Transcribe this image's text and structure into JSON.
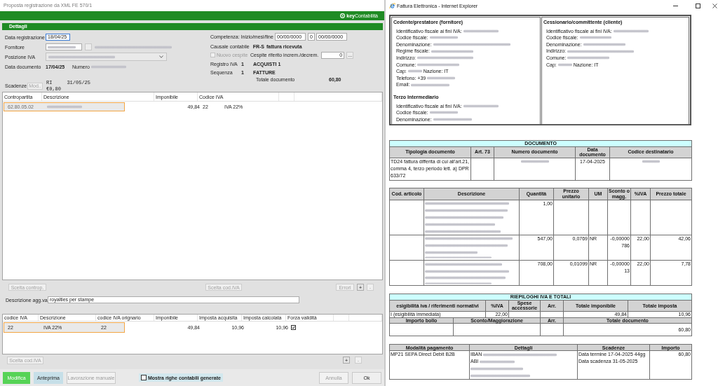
{
  "app_window": {
    "title": "Proposta registrazione da XML FE 570/1",
    "logo": "**key**Contabilità",
    "panel": {
      "title": "Dettagli",
      "left_fields": [
        {
          "kind": "input",
          "label": "Data registrazione",
          "value": "18/04/25",
          "focused": true
        },
        {
          "kind": "lookup",
          "label": "Fornitore",
          "value_blurred": true,
          "name_blurred": true
        },
        {
          "kind": "select",
          "label": "Posizione IVA",
          "blurred": true
        },
        {
          "kind": "document",
          "label": "Data documento",
          "value": "17/04/25",
          "number_label": "Numero",
          "blurred": true
        }
      ],
      "due_dates": {
        "label": "Scadenze",
        "button": {
          "label": "Mod..",
          "disabled": true
        },
        "lines": [
          "RI     31/05/25",
          "€0,80"
        ]
      },
      "right_fields": [
        {
          "kind": "dates",
          "label": "Competenza: Inizio/mesi/fine",
          "start": "00/00/0000",
          "months": "0",
          "end": "00/00/0000"
        },
        {
          "kind": "code",
          "label": "Causale contabile",
          "code": "FR-S",
          "text": "fattura ricevuta"
        },
        {
          "kind": "asset",
          "checkbox": {
            "label": "Nuovo cespite",
            "checked": false,
            "disabled": true
          },
          "label": "Cespite riferito increm./decrem.",
          "value": "0",
          "button": "..."
        },
        {
          "kind": "code",
          "label": "Registro IVA",
          "code": "1",
          "text": "ACQUISTI 1"
        },
        {
          "kind": "code",
          "label": "Sequenza",
          "code": "1",
          "text": "FATTURE"
        },
        {
          "kind": "total",
          "label": "Totale documento",
          "value": "60,80"
        }
      ]
    },
    "accounts_grid": {
      "columns": [
        "Contropartita",
        "Descrizione",
        "Imponibile",
        "Codice IVA"
      ],
      "rows": [
        {
          "selected": true,
          "account": "62.80.05.02",
          "description_blurred": true,
          "taxable": "49,84",
          "vat_code": "22",
          "vat_description": "IVA 22%"
        }
      ]
    },
    "accounts_buttons": [
      {
        "label": "Scelta controp.",
        "disabled": true
      },
      {
        "label": "Scelta cod.IVA",
        "disabled": true
      },
      {
        "label": "Errori",
        "disabled": true
      },
      {
        "label": "+",
        "disabled": false
      },
      {
        "label": "-",
        "disabled": true
      }
    ],
    "additional_description": {
      "label": "Descrizione agg.va",
      "value": "royalties per stampe"
    },
    "vat_grid": {
      "columns": [
        "codice IVA",
        "Descrizione",
        "codice IVA orignario",
        "Imponibile",
        "Imposta acquisita",
        "Imposta calcolata",
        "Forza validità"
      ],
      "rows": [
        {
          "selected": true,
          "vat_code": "22",
          "description": "IVA 22%",
          "original_vat_code": "22",
          "taxable": "49,84",
          "tax_received": "10,96",
          "tax_computed": "10,96",
          "force_valid": true
        }
      ]
    },
    "vat_buttons": [
      {
        "label": "Scelta cod.IVA",
        "disabled": true
      },
      {
        "label": "+",
        "disabled": false
      },
      {
        "label": "-",
        "disabled": true
      }
    ],
    "footer": {
      "buttons": [
        {
          "label": "Modifica",
          "kind": "primary",
          "disabled": false
        },
        {
          "label": "Anteprima",
          "kind": "secondary",
          "disabled": false
        },
        {
          "label": "Lavorazione manuale",
          "kind": "default",
          "disabled": true
        }
      ],
      "checkbox": {
        "label": "Mostra righe contabili generate",
        "checked": false
      },
      "dialog_buttons": [
        {
          "label": "Annulla",
          "disabled": true
        },
        {
          "label": "Ok",
          "disabled": false
        }
      ]
    }
  },
  "browser_window": {
    "title": "Fattura Elettronica - Internet Explorer",
    "parties": [
      [
        {
          "title": "Cedente/prestatore (fornitore)",
          "lines": [
            {
              "label": "Identificativo fiscale ai fini IVA:",
              "blurred": true
            },
            {
              "label": "Codice fiscale:",
              "blurred": true
            },
            {
              "label": "Denominazione:",
              "blurred": true
            },
            {
              "label": "Regime fiscale:",
              "blurred": true
            },
            {
              "label": "Indirizzo:",
              "blurred": true
            },
            {
              "label": "Comune:",
              "blurred": true
            },
            {
              "label": "Cap:",
              "blurred": true,
              "suffix": "Nazione: IT"
            },
            {
              "label": "Telefono: +39",
              "blurred": true
            },
            {
              "label": "Email:",
              "blurred": true
            }
          ]
        },
        {
          "title": "Terzo Intermediario",
          "lines": [
            {
              "label": "Identificativo fiscale ai fini IVA:",
              "blurred": true
            },
            {
              "label": "Codice fiscale:",
              "blurred": true
            },
            {
              "label": "Denominazione:",
              "blurred": true
            }
          ]
        }
      ],
      [
        {
          "title": "Cessionario/committente (cliente)",
          "lines": [
            {
              "label": "Identificativo fiscale ai fini IVA:",
              "blurred": true
            },
            {
              "label": "Codice fiscale:",
              "blurred": true
            },
            {
              "label": "Denominazione:",
              "blurred": true
            },
            {
              "label": "Indirizzo:",
              "blurred": true
            },
            {
              "label": "Comune:",
              "blurred": true
            },
            {
              "label": "Cap:",
              "blurred": true,
              "suffix": "Nazione: IT"
            }
          ]
        }
      ]
    ],
    "document": {
      "title": "DOCUMENTO",
      "columns": [
        "Tipologia documento",
        "Art. 73",
        "Numero documento",
        "Data documento",
        "Codice destinatario"
      ],
      "rows": [
        [
          "TD24 fattura differita di cui all'art.21, comma 4, terzo periodo lett. a) DPR 633/72",
          null,
          {
            "lines": [
              {
                "blurred": true
              }
            ]
          },
          "17-04-2025",
          {
            "lines": [
              {
                "blurred": true
              }
            ]
          }
        ]
      ]
    },
    "items": {
      "columns": [
        "Cod. articolo",
        "Descrizione",
        "Quantità",
        "Prezzo unitario",
        "UM",
        "Sconto o magg.",
        "%IVA",
        "Prezzo totale"
      ],
      "rows": [
        [
          null,
          {
            "lines": [
              {
                "blurred": true
              },
              {
                "blurred": true
              },
              {
                "blurred": true
              },
              {
                "blurred": true
              },
              {
                "blurred": true
              }
            ]
          },
          "1,00",
          null,
          null,
          null,
          null,
          null
        ],
        [
          null,
          {
            "lines": [
              {
                "blurred": true
              },
              {
                "blurred": true
              },
              {
                "blurred": true
              },
              {
                "blurred": true,
                "small": true
              }
            ]
          },
          "547,00",
          "0,0769",
          "NR",
          "-0,00000786",
          "22,00",
          "42,06"
        ],
        [
          null,
          {
            "lines": [
              {
                "blurred": true
              },
              {
                "blurred": true
              },
              {
                "blurred": true
              },
              {
                "blurred": true,
                "small": true
              }
            ]
          },
          "708,00",
          "0,01099",
          "NR",
          "-0,0000013",
          "22,00",
          "7,78"
        ]
      ]
    },
    "summary": {
      "title": "RIEPILOGHI IVA E TOTALI",
      "columns": [
        "esigibilità iva / riferimenti normativi",
        "%IVA",
        "Spese accessorie",
        "Arr.",
        "Totale imponibile",
        "Totale imposta"
      ],
      "rows": [
        [
          "I (esigibilità immediata)",
          "22,00",
          null,
          null,
          "49,84",
          "10,96"
        ]
      ],
      "totals_columns": [
        "Importo bollo",
        "Sconto/Maggiorazione",
        "Arr.",
        "Totale documento"
      ],
      "totals_rows": [
        [
          null,
          null,
          null,
          "60,80"
        ]
      ]
    },
    "payment": {
      "columns": [
        "Modalità pagamento",
        "Dettagli",
        "Scadenze",
        "Importo"
      ],
      "rows": [
        [
          "MP21 SEPA Direct Debit B2B",
          {
            "lines": [
              {
                "label": "IBAN",
                "blurred": true
              },
              {
                "label": "ABI",
                "blurred": true
              },
              {
                "blurred": true
              },
              {
                "blurred": true
              }
            ]
          },
          {
            "lines": [
              {
                "label": "Data termine 17-04-2025 44gg"
              },
              {
                "label": "Data scadenza 31-05-2025"
              }
            ]
          },
          "60,80"
        ]
      ]
    }
  }
}
